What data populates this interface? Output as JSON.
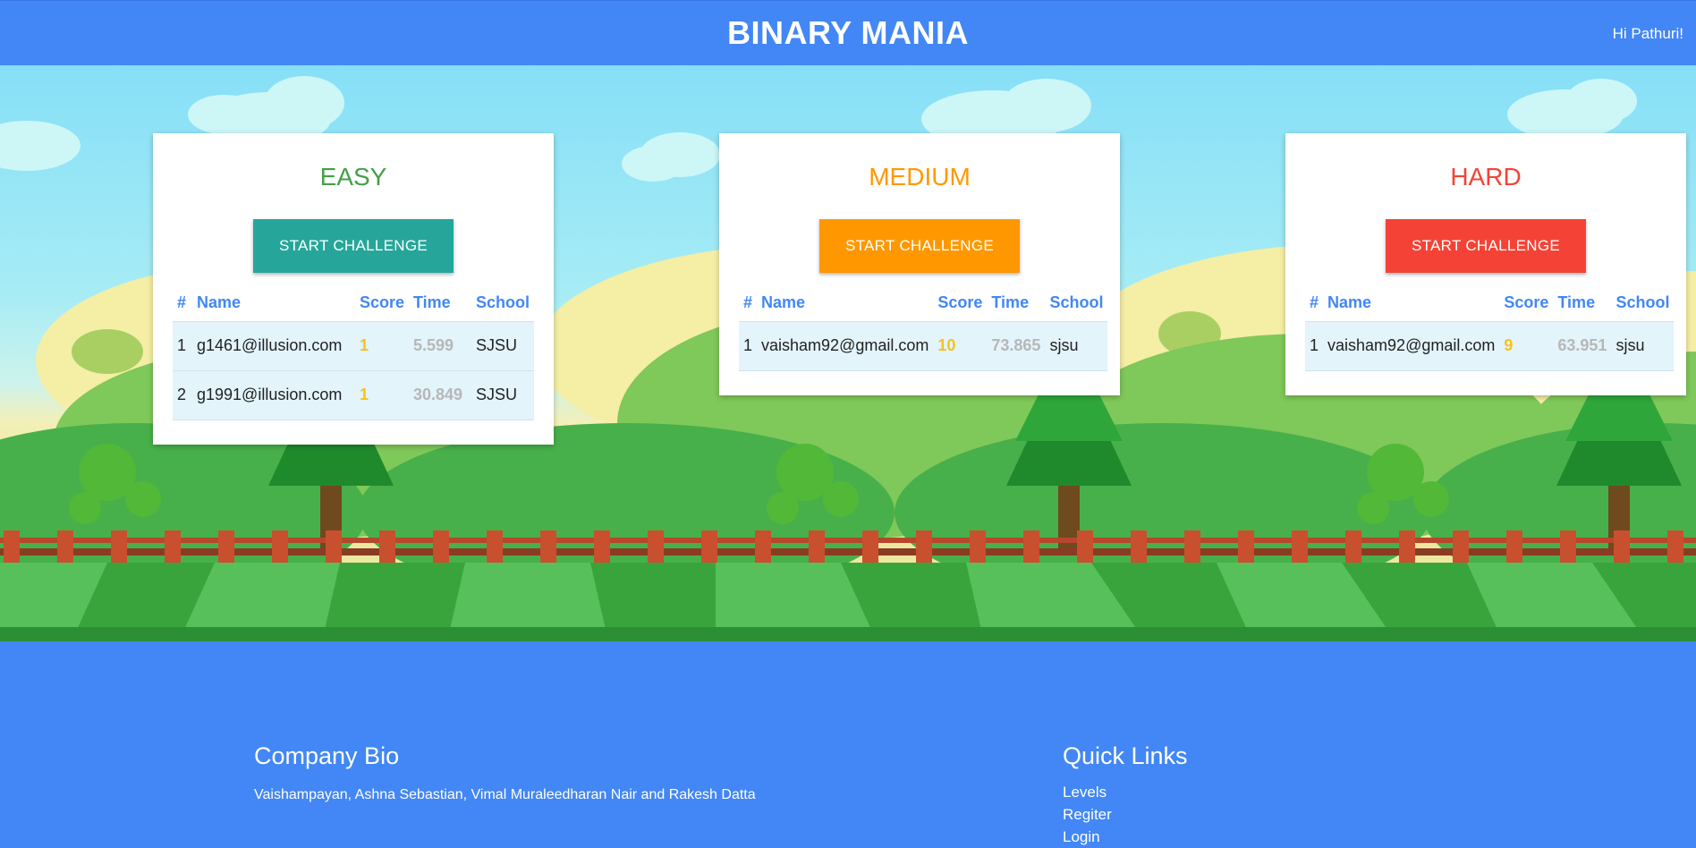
{
  "header": {
    "title": "BINARY MANIA",
    "greeting": "Hi Pathuri!"
  },
  "colors": {
    "header_bg": "#4287f5",
    "easy": "#43a047",
    "medium": "#ff9800",
    "hard": "#f44336",
    "easy_button": "#26a69a",
    "score": "#f7c21a",
    "time": "#b7b7b7"
  },
  "table_headers": [
    "#",
    "Name",
    "Score",
    "Time",
    "School"
  ],
  "levels": [
    {
      "title": "EASY",
      "button_label": "START CHALLENGE",
      "rows": [
        {
          "rank": "1",
          "name": "g1461@illusion.com",
          "score": "1",
          "time": "5.599",
          "school": "SJSU"
        },
        {
          "rank": "2",
          "name": "g1991@illusion.com",
          "score": "1",
          "time": "30.849",
          "school": "SJSU"
        }
      ]
    },
    {
      "title": "MEDIUM",
      "button_label": "START CHALLENGE",
      "rows": [
        {
          "rank": "1",
          "name": "vaisham92@gmail.com",
          "score": "10",
          "time": "73.865",
          "school": "sjsu"
        }
      ]
    },
    {
      "title": "HARD",
      "button_label": "START CHALLENGE",
      "rows": [
        {
          "rank": "1",
          "name": "vaisham92@gmail.com",
          "score": "9",
          "time": "63.951",
          "school": "sjsu"
        }
      ]
    }
  ],
  "footer": {
    "bio_heading": "Company Bio",
    "bio_text": "Vaishampayan, Ashna Sebastian, Vimal Muraleedharan Nair and Rakesh Datta",
    "links_heading": "Quick Links",
    "links": [
      "Levels",
      "Regiter",
      "Login"
    ]
  }
}
